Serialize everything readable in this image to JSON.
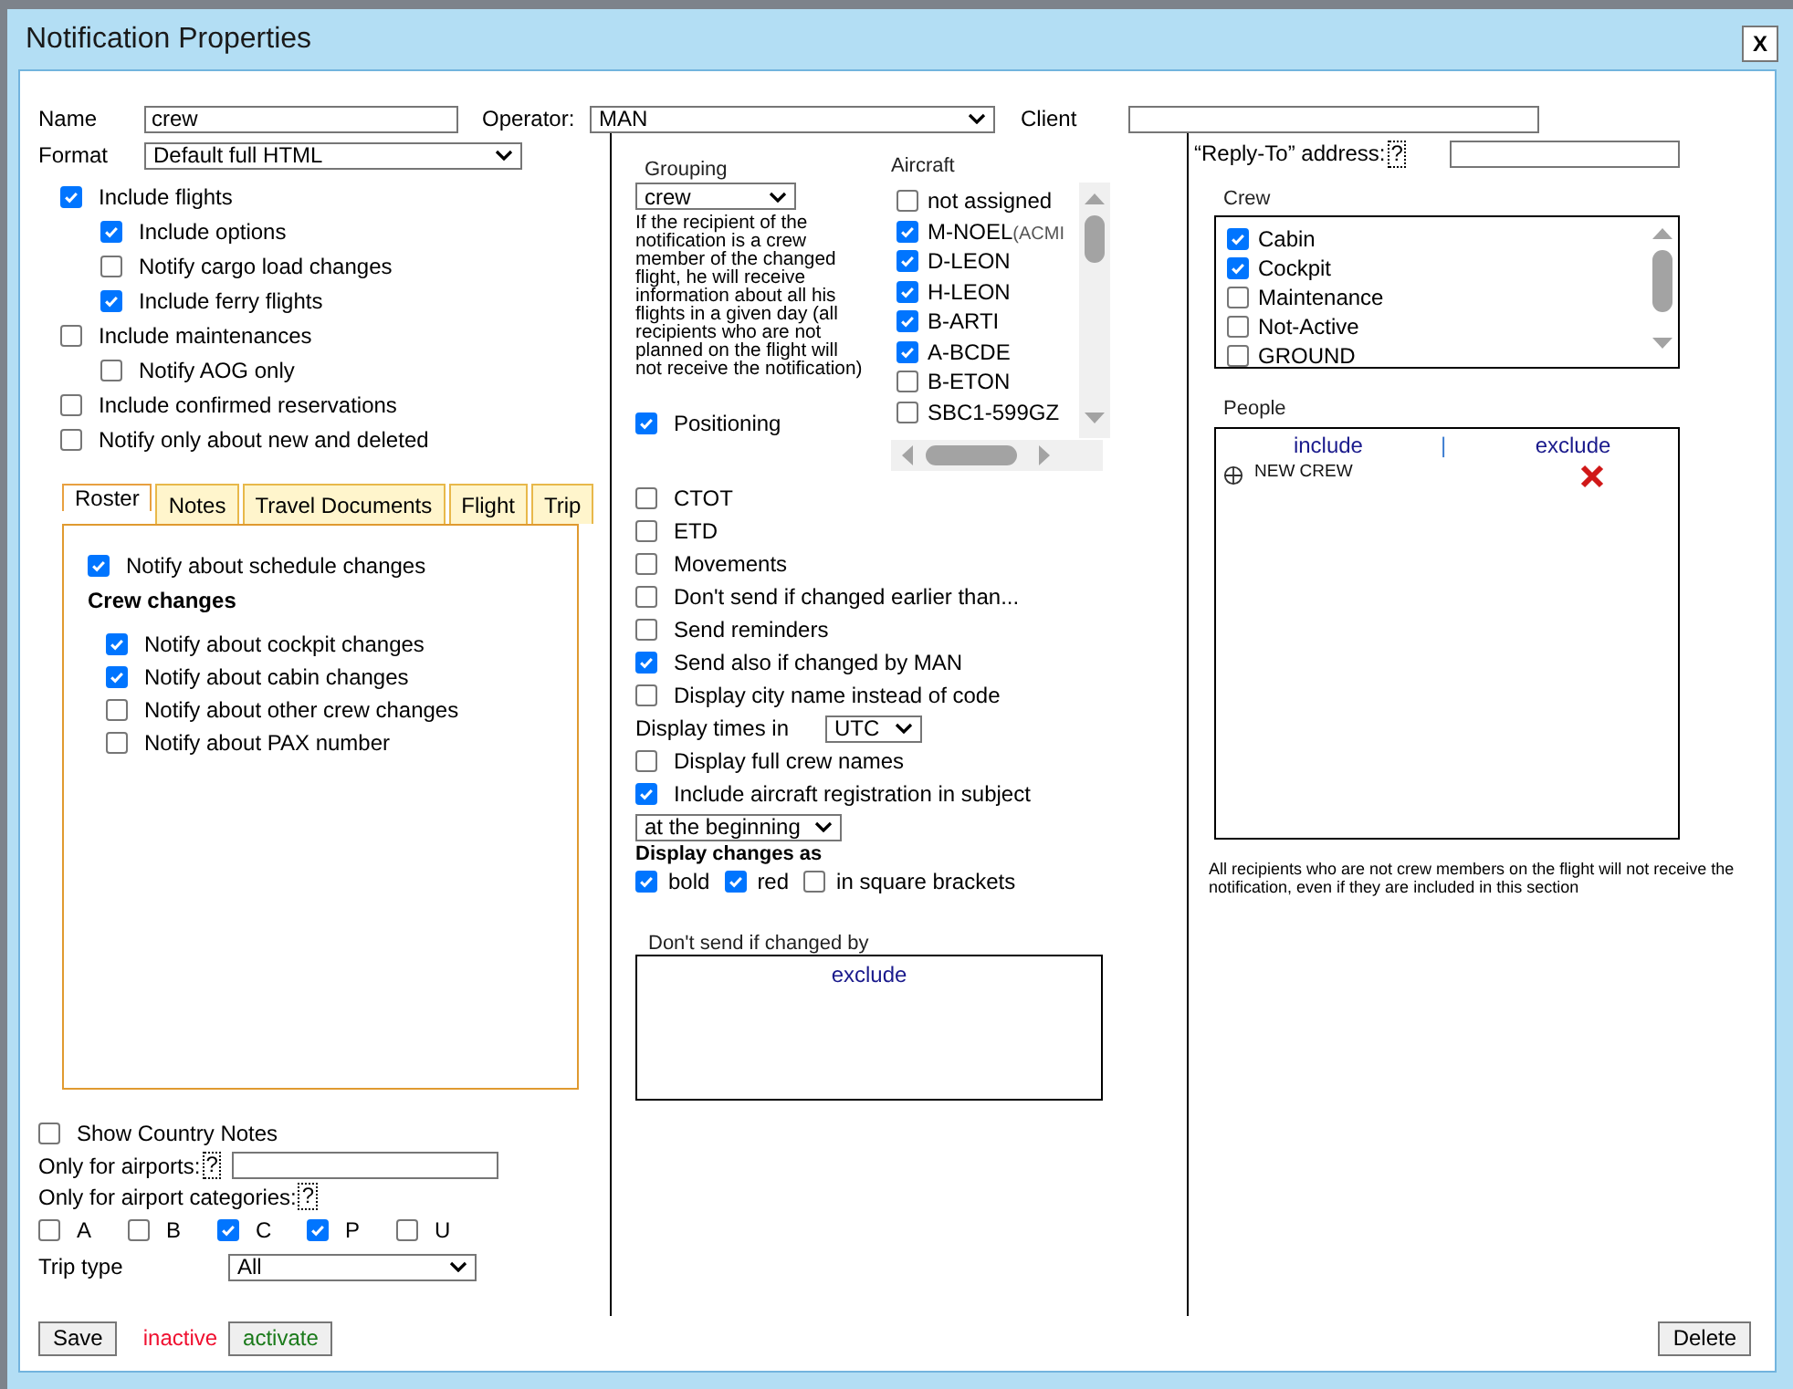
{
  "window": {
    "title": "Notification Properties",
    "close": "X"
  },
  "name": {
    "label": "Name",
    "value": "crew"
  },
  "operator": {
    "label": "Operator:",
    "value": "MAN"
  },
  "client": {
    "label": "Client"
  },
  "format": {
    "label": "Format",
    "value": "Default full HTML"
  },
  "flight_options": [
    {
      "label": "Include flights",
      "checked": true,
      "children": [
        {
          "label": "Include options",
          "checked": true
        },
        {
          "label": "Notify cargo load changes",
          "checked": false
        },
        {
          "label": "Include ferry flights",
          "checked": true
        }
      ]
    },
    {
      "label": "Include maintenances",
      "checked": false,
      "children": [
        {
          "label": "Notify AOG only",
          "checked": false
        }
      ]
    },
    {
      "label": "Include confirmed reservations",
      "checked": false
    },
    {
      "label": "Notify only about new and deleted",
      "checked": false
    }
  ],
  "tabs": [
    {
      "label": "Roster",
      "selected": true
    },
    {
      "label": "Notes",
      "selected": false
    },
    {
      "label": "Travel Documents",
      "selected": false
    },
    {
      "label": "Flight",
      "selected": false
    },
    {
      "label": "Trip",
      "selected": false
    }
  ],
  "roster": {
    "schedule": {
      "label": "Notify about schedule changes",
      "checked": true
    },
    "heading": "Crew changes",
    "items": [
      {
        "label": "Notify about cockpit changes",
        "checked": true
      },
      {
        "label": "Notify about cabin changes",
        "checked": true
      },
      {
        "label": "Notify about other crew changes",
        "checked": false
      },
      {
        "label": "Notify about PAX number",
        "checked": false
      }
    ]
  },
  "country_notes": {
    "label": "Show Country Notes",
    "checked": false
  },
  "airports": {
    "label": "Only for airports:",
    "help": "?"
  },
  "airport_categories": {
    "label": "Only for airport categories:",
    "help": "?",
    "items": [
      {
        "label": "A",
        "checked": false
      },
      {
        "label": "B",
        "checked": false
      },
      {
        "label": "C",
        "checked": true
      },
      {
        "label": "P",
        "checked": true
      },
      {
        "label": "U",
        "checked": false
      }
    ]
  },
  "trip_type": {
    "label": "Trip type",
    "value": "All"
  },
  "grouping": {
    "label": "Grouping",
    "value": "crew",
    "description": "If the recipient of the notification is a crew member of the changed flight, he will receive information about all his flights in a given day (all recipients who are not planned on the flight will not receive the notification)"
  },
  "positioning": {
    "label": "Positioning",
    "checked": true
  },
  "aircraft": {
    "label": "Aircraft",
    "items": [
      {
        "label": "not assigned",
        "checked": false
      },
      {
        "label": "M-NOEL",
        "note": "(ACMI",
        "checked": true
      },
      {
        "label": "D-LEON",
        "checked": true
      },
      {
        "label": "H-LEON",
        "checked": true
      },
      {
        "label": "B-ARTI",
        "checked": true
      },
      {
        "label": "A-BCDE",
        "checked": true
      },
      {
        "label": "B-ETON",
        "checked": false
      },
      {
        "label": "SBC1-599GZ",
        "checked": false
      }
    ]
  },
  "send_options": [
    {
      "kind": "check",
      "label": "CTOT",
      "checked": false
    },
    {
      "kind": "check",
      "label": "ETD",
      "checked": false
    },
    {
      "kind": "check",
      "label": "Movements",
      "checked": false
    },
    {
      "kind": "check",
      "label": "Don't send if changed earlier than...",
      "checked": false
    },
    {
      "kind": "check",
      "label": "Send reminders",
      "checked": false
    },
    {
      "kind": "check",
      "label": "Send also if changed by MAN",
      "checked": true
    },
    {
      "kind": "check",
      "label": "Display city name instead of code",
      "checked": false
    },
    {
      "kind": "select",
      "label": "Display times in",
      "value": "UTC"
    },
    {
      "kind": "check",
      "label": "Display full crew names",
      "checked": false
    },
    {
      "kind": "check",
      "label": "Include aircraft registration in subject",
      "checked": true
    },
    {
      "kind": "select",
      "value": "at the beginning"
    }
  ],
  "display_changes": {
    "label": "Display changes as",
    "options": [
      {
        "label": "bold",
        "checked": true
      },
      {
        "label": "red",
        "checked": true
      },
      {
        "label": "in square brackets",
        "checked": false
      }
    ]
  },
  "dont_send_by": {
    "label": "Don't send if changed by",
    "column": "exclude"
  },
  "reply_to": {
    "label": "“Reply-To” address:",
    "help": "?"
  },
  "crew": {
    "label": "Crew",
    "items": [
      {
        "label": "Cabin",
        "checked": true
      },
      {
        "label": "Cockpit",
        "checked": true
      },
      {
        "label": "Maintenance",
        "checked": false
      },
      {
        "label": "Not-Active",
        "checked": false
      },
      {
        "label": "GROUND",
        "checked": false
      }
    ]
  },
  "people": {
    "label": "People",
    "include": "include",
    "separator": "|",
    "exclude": "exclude",
    "rows": [
      {
        "name": "NEW CREW"
      }
    ]
  },
  "people_note": "All recipients who are not crew members on the flight will not receive the notification, even if they are included in this section",
  "footer": {
    "save": "Save",
    "status": "inactive",
    "activate": "activate",
    "delete": "Delete"
  }
}
